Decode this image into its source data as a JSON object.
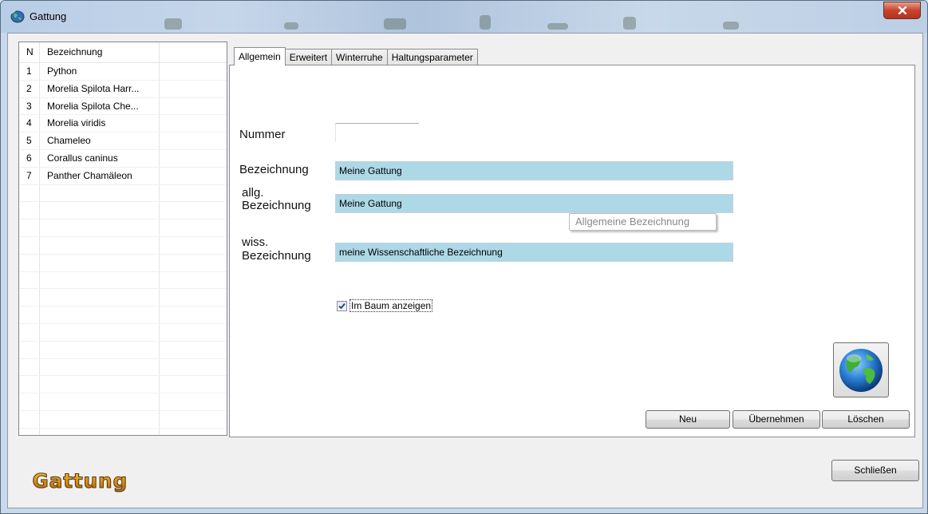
{
  "window": {
    "title": "Gattung"
  },
  "list": {
    "columns": [
      "N",
      "Bezeichnung",
      ""
    ],
    "rows": [
      {
        "n": "1",
        "name": "Python"
      },
      {
        "n": "2",
        "name": "Morelia Spilota Harr..."
      },
      {
        "n": "3",
        "name": "Morelia Spilota Che..."
      },
      {
        "n": "4",
        "name": "Morelia viridis"
      },
      {
        "n": "5",
        "name": "Chameleo"
      },
      {
        "n": "6",
        "name": "Corallus caninus"
      },
      {
        "n": "7",
        "name": "Panther Chamäleon"
      }
    ]
  },
  "tabs": [
    {
      "label": "Allgemein",
      "active": true
    },
    {
      "label": "Erweitert",
      "active": false
    },
    {
      "label": "Winterruhe",
      "active": false
    },
    {
      "label": "Haltungsparameter",
      "active": false
    }
  ],
  "form": {
    "nummer_label": "Nummer",
    "nummer_value": "",
    "bezeichnung_label": "Bezeichnung",
    "bezeichnung_value": "Meine Gattung",
    "allg_label_1": "allg.",
    "allg_label_2": "Bezeichnung",
    "allg_value": "Meine Gattung",
    "tooltip": "Allgemeine Bezeichnung",
    "wiss_label_1": "wiss.",
    "wiss_label_2": "Bezeichnung",
    "wiss_value": "meine Wissenschaftliche Bezeichnung",
    "checkbox_label": "Im Baum anzeigen",
    "checkbox_checked": true,
    "field_color": "#add8e6"
  },
  "buttons": {
    "neu": "Neu",
    "uebernehmen": "Übernehmen",
    "loeschen": "Löschen",
    "schliessen": "Schließen"
  },
  "logo_text": "Gattung",
  "icons": [
    "app-globe-icon",
    "close-icon",
    "globe-icon",
    "checkmark-icon"
  ]
}
